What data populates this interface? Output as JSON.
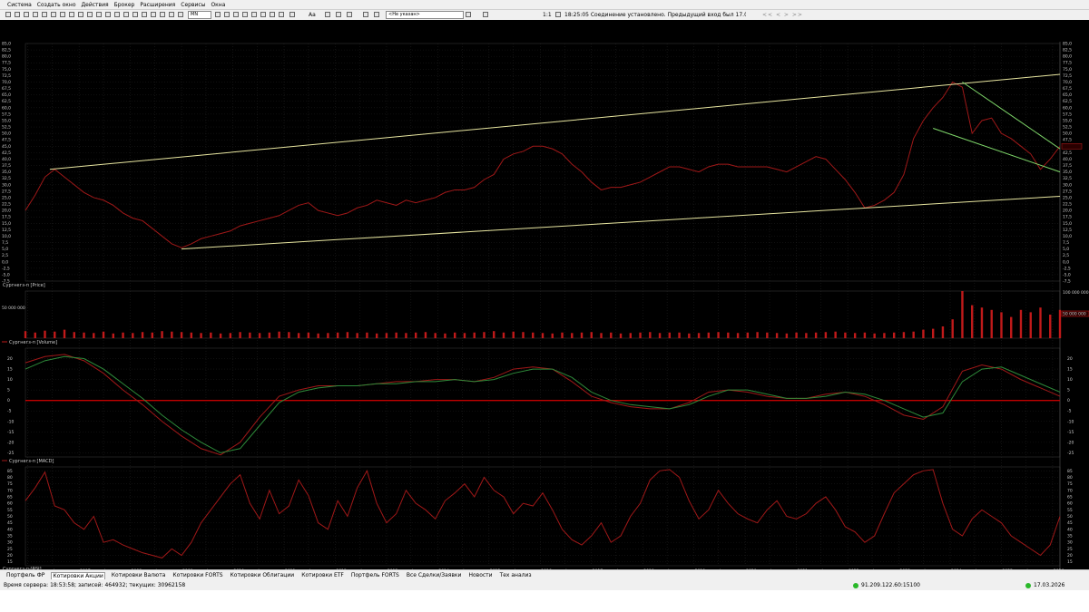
{
  "menu": [
    "Система",
    "Создать окно",
    "Действия",
    "Брокер",
    "Расширения",
    "Сервисы",
    "Окна"
  ],
  "toolbar": {
    "interval": "MN",
    "font_size": "Аа",
    "instrument_placeholder": "<Не указан>",
    "scale": "1:1",
    "message": "18:25:05 Соединение установлено. Предыдущий вход был 17.03.2026 6:16:05 с"
  },
  "panels": {
    "price": {
      "label": "Сургнегз-п [Price]"
    },
    "volume": {
      "label": "Сургнегз-п [Volume]",
      "left_value": "50 000 000",
      "right_top": "100 000 000",
      "right_mid": "50 000 000"
    },
    "macd": {
      "label": "Сургнегз-п [MACD]"
    },
    "rsi": {
      "label": "Сургнегз-п [RSI]"
    }
  },
  "price_axis": [
    "85,0",
    "82,5",
    "80,0",
    "77,5",
    "75,0",
    "72,5",
    "70,0",
    "67,5",
    "65,0",
    "62,5",
    "60,0",
    "57,5",
    "55,0",
    "52,5",
    "50,0",
    "47,5",
    "45,0",
    "42,5",
    "40,0",
    "37,5",
    "35,0",
    "32,5",
    "30,0",
    "27,5",
    "25,0",
    "22,5",
    "20,0",
    "17,5",
    "15,0",
    "12,5",
    "10,0",
    "7,5",
    "5,0",
    "2,5",
    "0,0",
    "-2,5",
    "-5,0",
    "-7,5"
  ],
  "macd_axis": [
    "20",
    "15",
    "10",
    "5",
    "0",
    "-5",
    "-10",
    "-15",
    "-20",
    "-25"
  ],
  "rsi_axis": [
    "85",
    "80",
    "75",
    "70",
    "65",
    "60",
    "55",
    "50",
    "45",
    "40",
    "35",
    "30",
    "25",
    "20",
    "15"
  ],
  "x_axis": [
    {
      "t": "2006",
      "x": 0.5
    },
    {
      "t": "Jun",
      "x": 5.5
    },
    {
      "t": "2007",
      "x": 11.0
    },
    {
      "t": "Jun",
      "x": 16.0
    },
    {
      "t": "2008",
      "x": 21.5
    },
    {
      "t": "Jun",
      "x": 26.5
    },
    {
      "t": "2009",
      "x": 32.0
    },
    {
      "t": "Jun",
      "x": 37.0
    },
    {
      "t": "2010",
      "x": 42.5
    },
    {
      "t": "Jun",
      "x": 47.5
    },
    {
      "t": "2011",
      "x": 53.0
    },
    {
      "t": "Jun",
      "x": 58.0
    },
    {
      "t": "2012",
      "x": 63.5
    },
    {
      "t": "Jun",
      "x": 68.5
    },
    {
      "t": "2013",
      "x": 74.0
    },
    {
      "t": "Jun",
      "x": 79.0
    },
    {
      "t": "2014",
      "x": 84.5
    },
    {
      "t": "Jun",
      "x": 89.5
    },
    {
      "t": "2015",
      "x": 95.0
    },
    {
      "t": "Jun",
      "x": 100.0
    },
    {
      "t": "2016",
      "x": 105.5
    },
    {
      "t": "Jun",
      "x": 110.5
    },
    {
      "t": "2017",
      "x": 116.0
    },
    {
      "t": "Jun",
      "x": 121.0
    },
    {
      "t": "2018",
      "x": 126.5
    },
    {
      "t": "Jun",
      "x": 131.5
    },
    {
      "t": "2019",
      "x": 137.0
    },
    {
      "t": "Jun",
      "x": 142.0
    },
    {
      "t": "2020",
      "x": 147.5
    },
    {
      "t": "Jun",
      "x": 152.5
    },
    {
      "t": "2021",
      "x": 158.0
    },
    {
      "t": "Jun",
      "x": 163.0
    },
    {
      "t": "2022",
      "x": 168.5
    },
    {
      "t": "Jun",
      "x": 173.5
    },
    {
      "t": "2023",
      "x": 179.0
    },
    {
      "t": "Jun",
      "x": 184.0
    },
    {
      "t": "2024",
      "x": 189.5
    },
    {
      "t": "Jun",
      "x": 194.5
    },
    {
      "t": "2025",
      "x": 200.0
    },
    {
      "t": "Jun",
      "x": 205.0
    },
    {
      "t": "2026",
      "x": 210.5
    }
  ],
  "tabs": [
    "Портфель ФР",
    "Котировки Акции",
    "Котировки Валюта",
    "Котировки FORTS",
    "Котировки Облигации",
    "Котировки ETF",
    "Портфель FORTS",
    "Все Сделки/Заявки",
    "Новости",
    "Тех анализ"
  ],
  "active_tab": 1,
  "status": {
    "server_time": "Время сервера: 18:53:58; записей: 464932; текущих: 30962158",
    "ip": "91.209.122.60:15100",
    "date": "17.03.2026"
  },
  "colors": {
    "price": "#a01818",
    "trend_yellow": "#e8e6a0",
    "trend_green": "#7fd86a",
    "volume": "#c01a1a",
    "macd_signal": "#2e8b3a",
    "zero_line": "#c00000"
  },
  "chart_data": [
    {
      "type": "line",
      "name": "price",
      "x_range": [
        0,
        212
      ],
      "ylim": [
        -7.5,
        85
      ],
      "series": [
        {
          "name": "Сургнегз-п [Price]",
          "x": [
            0,
            2,
            4,
            6,
            8,
            10,
            12,
            14,
            16,
            18,
            20,
            22,
            24,
            26,
            28,
            30,
            32,
            34,
            36,
            38,
            40,
            42,
            44,
            46,
            48,
            50,
            52,
            54,
            56,
            58,
            60,
            62,
            64,
            66,
            68,
            70,
            72,
            74,
            76,
            78,
            80,
            82,
            84,
            86,
            88,
            90,
            92,
            94,
            96,
            98,
            100,
            102,
            104,
            106,
            108,
            110,
            112,
            114,
            116,
            118,
            120,
            122,
            124,
            126,
            128,
            130,
            132,
            134,
            136,
            138,
            140,
            142,
            144,
            146,
            148,
            150,
            152,
            154,
            156,
            158,
            160,
            162,
            164,
            166,
            168,
            170,
            172,
            174,
            176,
            178,
            180,
            182,
            184,
            186,
            188,
            190,
            192,
            194,
            196,
            198,
            200,
            202,
            204,
            206,
            208,
            210,
            212
          ],
          "y": [
            20,
            26,
            33,
            36,
            33,
            30,
            27,
            25,
            24,
            22,
            19,
            17,
            16,
            13,
            10,
            7,
            5.5,
            7,
            9,
            10,
            11,
            12,
            14,
            15,
            16,
            17,
            18,
            20,
            22,
            23,
            20,
            19,
            18,
            19,
            21,
            22,
            24,
            23,
            22,
            24,
            23,
            24,
            25,
            27,
            28,
            28,
            29,
            32,
            34,
            40,
            42,
            43,
            45,
            45,
            44,
            42,
            38,
            35,
            31,
            28,
            29,
            29,
            30,
            31,
            33,
            35,
            37,
            37,
            36,
            35,
            37,
            38,
            38,
            37,
            37,
            37,
            37,
            36,
            35,
            37,
            39,
            41,
            40,
            36,
            32,
            27,
            21,
            22,
            24,
            27,
            34,
            48,
            55,
            60,
            64,
            70,
            68,
            50,
            55,
            56,
            50,
            48,
            45,
            42,
            36,
            40,
            45
          ]
        }
      ],
      "trendlines": [
        {
          "name": "upper",
          "color": "yellow",
          "x": [
            5,
            212
          ],
          "y": [
            36,
            73
          ]
        },
        {
          "name": "lower",
          "color": "yellow",
          "x": [
            32,
            212
          ],
          "y": [
            5,
            25.5
          ]
        },
        {
          "name": "green-1",
          "color": "green",
          "x": [
            192,
            212
          ],
          "y": [
            70,
            44
          ]
        },
        {
          "name": "green-2",
          "color": "green",
          "x": [
            186,
            212
          ],
          "y": [
            52,
            35
          ]
        }
      ]
    },
    {
      "type": "bar",
      "name": "volume",
      "x_range": [
        0,
        212
      ],
      "ylim": [
        0,
        100000000
      ],
      "x": [
        0,
        2,
        4,
        6,
        8,
        10,
        12,
        14,
        16,
        18,
        20,
        22,
        24,
        26,
        28,
        30,
        32,
        34,
        36,
        38,
        40,
        42,
        44,
        46,
        48,
        50,
        52,
        54,
        56,
        58,
        60,
        62,
        64,
        66,
        68,
        70,
        72,
        74,
        76,
        78,
        80,
        82,
        84,
        86,
        88,
        90,
        92,
        94,
        96,
        98,
        100,
        102,
        104,
        106,
        108,
        110,
        112,
        114,
        116,
        118,
        120,
        122,
        124,
        126,
        128,
        130,
        132,
        134,
        136,
        138,
        140,
        142,
        144,
        146,
        148,
        150,
        152,
        154,
        156,
        158,
        160,
        162,
        164,
        166,
        168,
        170,
        172,
        174,
        176,
        178,
        180,
        182,
        184,
        186,
        188,
        190,
        192,
        194,
        196,
        198,
        200,
        202,
        204,
        206,
        208,
        210,
        212
      ],
      "values": [
        15,
        12,
        16,
        14,
        18,
        13,
        12,
        11,
        14,
        10,
        12,
        11,
        13,
        12,
        15,
        14,
        13,
        12,
        11,
        12,
        10,
        11,
        13,
        12,
        11,
        12,
        14,
        13,
        11,
        12,
        10,
        11,
        12,
        13,
        11,
        12,
        10,
        11,
        12,
        11,
        12,
        13,
        11,
        10,
        12,
        11,
        12,
        13,
        15,
        12,
        14,
        13,
        12,
        11,
        10,
        12,
        11,
        12,
        13,
        11,
        12,
        10,
        11,
        12,
        13,
        11,
        12,
        12,
        10,
        11,
        12,
        13,
        12,
        11,
        12,
        13,
        12,
        11,
        10,
        12,
        11,
        12,
        13,
        14,
        12,
        11,
        12,
        10,
        11,
        12,
        13,
        14,
        18,
        20,
        25,
        40,
        100,
        70,
        65,
        60,
        55,
        45,
        60,
        55,
        65,
        50,
        60
      ]
    },
    {
      "type": "line",
      "name": "macd",
      "x_range": [
        0,
        212
      ],
      "ylim": [
        -27,
        25
      ],
      "series": [
        {
          "name": "MACD",
          "x": [
            0,
            4,
            8,
            12,
            16,
            20,
            24,
            28,
            32,
            36,
            40,
            44,
            48,
            52,
            56,
            60,
            64,
            68,
            72,
            76,
            80,
            84,
            88,
            92,
            96,
            100,
            104,
            108,
            112,
            116,
            120,
            124,
            128,
            132,
            136,
            140,
            144,
            148,
            152,
            156,
            160,
            164,
            168,
            172,
            176,
            180,
            184,
            188,
            192,
            196,
            200,
            204,
            208,
            212
          ],
          "y": [
            18,
            21,
            22,
            19,
            13,
            5,
            -2,
            -10,
            -17,
            -23,
            -26,
            -20,
            -8,
            2,
            5,
            7,
            7,
            7,
            8,
            9,
            9,
            10,
            10,
            9,
            11,
            15,
            16,
            15,
            9,
            2,
            -1,
            -3,
            -4,
            -4,
            -1,
            4,
            5,
            4,
            2,
            1,
            1,
            3,
            4,
            2,
            -2,
            -7,
            -9,
            -3,
            14,
            17,
            15,
            10,
            6,
            2
          ]
        },
        {
          "name": "Signal",
          "x": [
            0,
            4,
            8,
            12,
            16,
            20,
            24,
            28,
            32,
            36,
            40,
            44,
            48,
            52,
            56,
            60,
            64,
            68,
            72,
            76,
            80,
            84,
            88,
            92,
            96,
            100,
            104,
            108,
            112,
            116,
            120,
            124,
            128,
            132,
            136,
            140,
            144,
            148,
            152,
            156,
            160,
            164,
            168,
            172,
            176,
            180,
            184,
            188,
            192,
            196,
            200,
            204,
            208,
            212
          ],
          "y": [
            15,
            19,
            21,
            20,
            15,
            8,
            1,
            -7,
            -14,
            -20,
            -25,
            -23,
            -12,
            -1,
            4,
            6,
            7,
            7,
            8,
            8,
            9,
            9,
            10,
            9,
            10,
            13,
            15,
            15,
            11,
            4,
            0,
            -2,
            -3,
            -4,
            -2,
            2,
            5,
            5,
            3,
            1,
            1,
            2,
            4,
            3,
            0,
            -4,
            -8,
            -6,
            9,
            15,
            16,
            12,
            8,
            4
          ]
        }
      ]
    },
    {
      "type": "line",
      "name": "rsi",
      "x_range": [
        0,
        212
      ],
      "ylim": [
        12,
        88
      ],
      "series": [
        {
          "name": "Сургнегз-п [RSI]",
          "x": [
            0,
            2,
            4,
            6,
            8,
            10,
            12,
            14,
            16,
            18,
            20,
            22,
            24,
            26,
            28,
            30,
            32,
            34,
            36,
            38,
            40,
            42,
            44,
            46,
            48,
            50,
            52,
            54,
            56,
            58,
            60,
            62,
            64,
            66,
            68,
            70,
            72,
            74,
            76,
            78,
            80,
            82,
            84,
            86,
            88,
            90,
            92,
            94,
            96,
            98,
            100,
            102,
            104,
            106,
            108,
            110,
            112,
            114,
            116,
            118,
            120,
            122,
            124,
            126,
            128,
            130,
            132,
            134,
            136,
            138,
            140,
            142,
            144,
            146,
            148,
            150,
            152,
            154,
            156,
            158,
            160,
            162,
            164,
            166,
            168,
            170,
            172,
            174,
            176,
            178,
            180,
            182,
            184,
            186,
            188,
            190,
            192,
            194,
            196,
            198,
            200,
            202,
            204,
            206,
            208,
            210,
            212
          ],
          "y": [
            62,
            72,
            84,
            58,
            55,
            45,
            40,
            50,
            30,
            32,
            28,
            25,
            22,
            20,
            18,
            25,
            20,
            30,
            45,
            55,
            65,
            75,
            82,
            60,
            48,
            70,
            52,
            58,
            78,
            66,
            45,
            40,
            62,
            50,
            72,
            85,
            60,
            45,
            52,
            70,
            60,
            55,
            48,
            62,
            68,
            75,
            65,
            80,
            70,
            65,
            52,
            60,
            58,
            68,
            55,
            40,
            32,
            28,
            35,
            45,
            30,
            35,
            50,
            60,
            78,
            85,
            86,
            80,
            62,
            48,
            55,
            70,
            60,
            52,
            48,
            45,
            55,
            62,
            50,
            48,
            52,
            60,
            65,
            55,
            42,
            38,
            30,
            35,
            52,
            68,
            75,
            82,
            85,
            86,
            60,
            40,
            35,
            48,
            55,
            50,
            45,
            35,
            30,
            25,
            20,
            28,
            50
          ]
        }
      ]
    }
  ]
}
